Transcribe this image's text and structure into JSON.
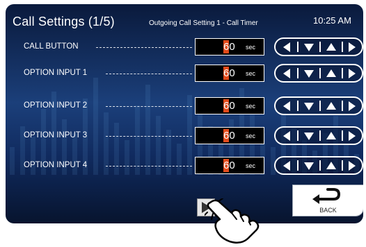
{
  "header": {
    "title": "Call Settings (1/5)",
    "subtitle": "Outgoing Call Setting 1 - Call Timer",
    "time": "10:25 AM"
  },
  "rows": [
    {
      "label": "CALL BUTTON",
      "digit": "6",
      "value": "0",
      "unit": "sec"
    },
    {
      "label": "OPTION INPUT 1",
      "digit": "6",
      "value": "0",
      "unit": "sec"
    },
    {
      "label": "OPTION INPUT 2",
      "digit": "6",
      "value": "0",
      "unit": "sec"
    },
    {
      "label": "OPTION INPUT 3",
      "digit": "6",
      "value": "0",
      "unit": "sec"
    },
    {
      "label": "OPTION INPUT 4",
      "digit": "6",
      "value": "0",
      "unit": "sec"
    }
  ],
  "nav_icons": [
    "left-arrow-icon",
    "down-arrow-icon",
    "up-arrow-icon",
    "right-arrow-icon"
  ],
  "back": {
    "label": "BACK",
    "icon": "back-return-icon"
  },
  "next": {
    "icon": "play-right-icon"
  },
  "colors": {
    "cursor": "#e24a1a",
    "background": "#1b3f7a",
    "text": "#ffffff"
  }
}
